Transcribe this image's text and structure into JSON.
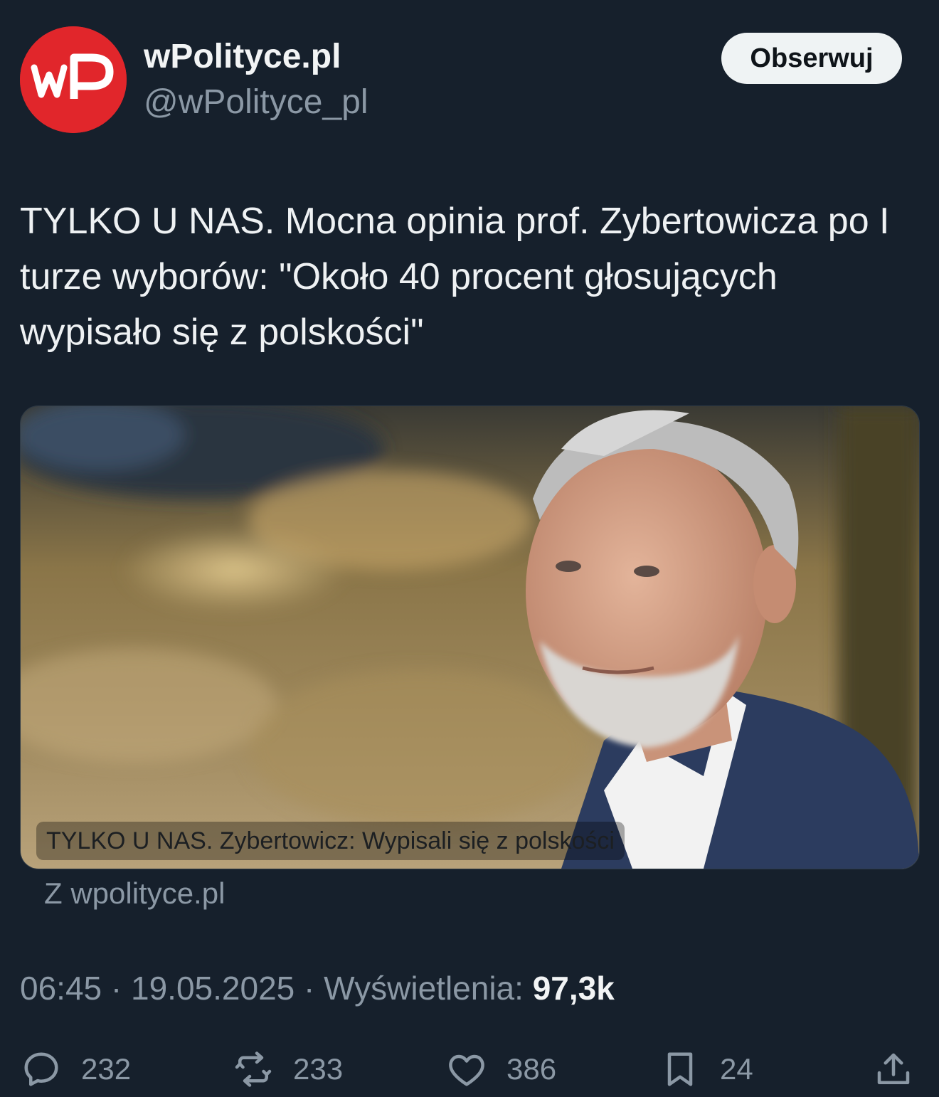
{
  "author": {
    "name": "wPolityce.pl",
    "handle": "@wPolityce_pl",
    "avatar_logo_text": "wP",
    "avatar_color": "#e1262b"
  },
  "follow_button_label": "Obserwuj",
  "tweet": {
    "text": "TYLKO U NAS. Mocna opinia prof. Zybertowicza po I turze wyborów: \"Około 40 procent głosujących wypisało się z polskości\""
  },
  "link_card": {
    "caption": "TYLKO U NAS. Zybertowicz: Wypisali się z polskości",
    "source": "Z wpolityce.pl"
  },
  "meta": {
    "time": "06:45",
    "separator": " · ",
    "date": "19.05.2025",
    "views_label": "Wyświetlenia: ",
    "views_count": "97,3k"
  },
  "actions": {
    "replies": {
      "icon": "reply-icon",
      "count": "232"
    },
    "reposts": {
      "icon": "repost-icon",
      "count": "233"
    },
    "likes": {
      "icon": "heart-icon",
      "count": "386"
    },
    "bookmarks": {
      "icon": "bookmark-icon",
      "count": "24"
    },
    "share": {
      "icon": "share-icon"
    }
  },
  "colors": {
    "background": "#16202c",
    "text_primary": "#e7e9ea",
    "text_secondary": "#8b98a5",
    "button_bg": "#eff3f4"
  }
}
